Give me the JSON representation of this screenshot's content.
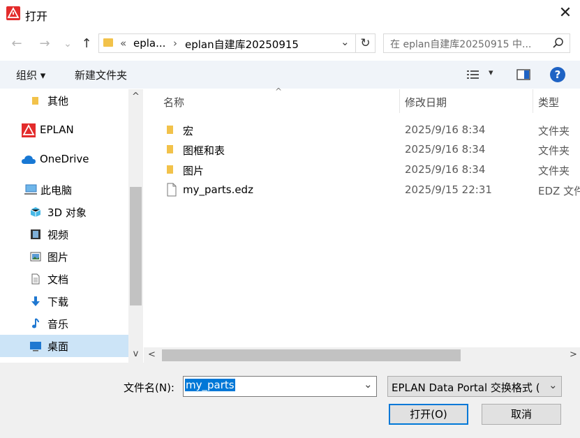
{
  "window": {
    "title": "打开",
    "close_glyph": "✕"
  },
  "icons": {
    "app": "eplan-logo-icon",
    "folder_color": "#f2c24a",
    "accent": "#0078d7",
    "help_bg": "#1f63c4"
  },
  "address": {
    "back_glyph": "←",
    "forward_glyph": "→",
    "recent_glyph": "⌄",
    "up_glyph": "↑",
    "chevron": "«",
    "crumb1": "epla...",
    "sep": "›",
    "crumb2": "eplan自建库20250915",
    "dropdown_glyph": "⌄",
    "refresh_glyph": "↻",
    "search_placeholder": "在 eplan自建库20250915 中..."
  },
  "toolbar": {
    "organize": "组织 ▾",
    "new_folder": "新建文件夹",
    "view_glyph": "▾",
    "help": "?"
  },
  "nav": {
    "items": [
      {
        "label": "其他",
        "icon": "folder-icon"
      },
      {
        "label": "EPLAN",
        "icon": "eplan-icon"
      },
      {
        "label": "OneDrive",
        "icon": "cloud-icon"
      },
      {
        "label": "此电脑",
        "icon": "computer-icon"
      },
      {
        "label": "3D 对象",
        "icon": "cube-icon"
      },
      {
        "label": "视频",
        "icon": "video-icon"
      },
      {
        "label": "图片",
        "icon": "picture-icon"
      },
      {
        "label": "文档",
        "icon": "document-icon"
      },
      {
        "label": "下载",
        "icon": "download-icon"
      },
      {
        "label": "音乐",
        "icon": "music-icon"
      },
      {
        "label": "桌面",
        "icon": "desktop-icon"
      }
    ],
    "scroll_up": "^",
    "scroll_down": "v"
  },
  "list": {
    "headers": {
      "name": "名称",
      "date": "修改日期",
      "type": "类型"
    },
    "sort_glyph": "^",
    "rows": [
      {
        "name": "宏",
        "date": "2025/9/16 8:34",
        "type": "文件夹",
        "icon": "folder-icon"
      },
      {
        "name": "图框和表",
        "date": "2025/9/16 8:34",
        "type": "文件夹",
        "icon": "folder-icon"
      },
      {
        "name": "图片",
        "date": "2025/9/16 8:34",
        "type": "文件夹",
        "icon": "folder-icon"
      },
      {
        "name": "my_parts.edz",
        "date": "2025/9/15 22:31",
        "type": "EDZ 文件",
        "icon": "file-icon"
      }
    ],
    "scroll_left": "<",
    "scroll_right": ">"
  },
  "footer": {
    "filename_label": "文件名(N):",
    "filename_value": "my_parts",
    "dropdown_glyph": "⌄",
    "filetype_value": "EPLAN Data Portal 交换格式 (",
    "open_button": "打开(O)",
    "cancel_button": "取消"
  }
}
